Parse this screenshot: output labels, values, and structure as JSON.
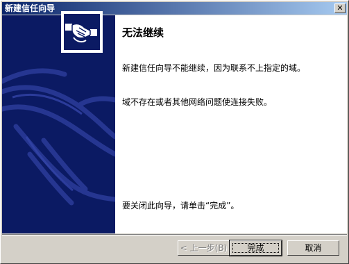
{
  "window": {
    "title": "新建信任向导",
    "close_symbol": "✕"
  },
  "panel": {
    "heading": "无法继续",
    "message1": "新建信任向导不能继续，因为联系不上指定的域。",
    "message2": "域不存在或者其他网络问题使连接失败。",
    "finish_hint": "要关闭此向导，请单击“完成”。"
  },
  "buttons": {
    "back": "< 上一步(B)",
    "finish": "完成",
    "cancel": "取消"
  },
  "colors": {
    "accent": "#0b1a63",
    "title_start": "#0a246a",
    "title_end": "#a6caf0"
  }
}
